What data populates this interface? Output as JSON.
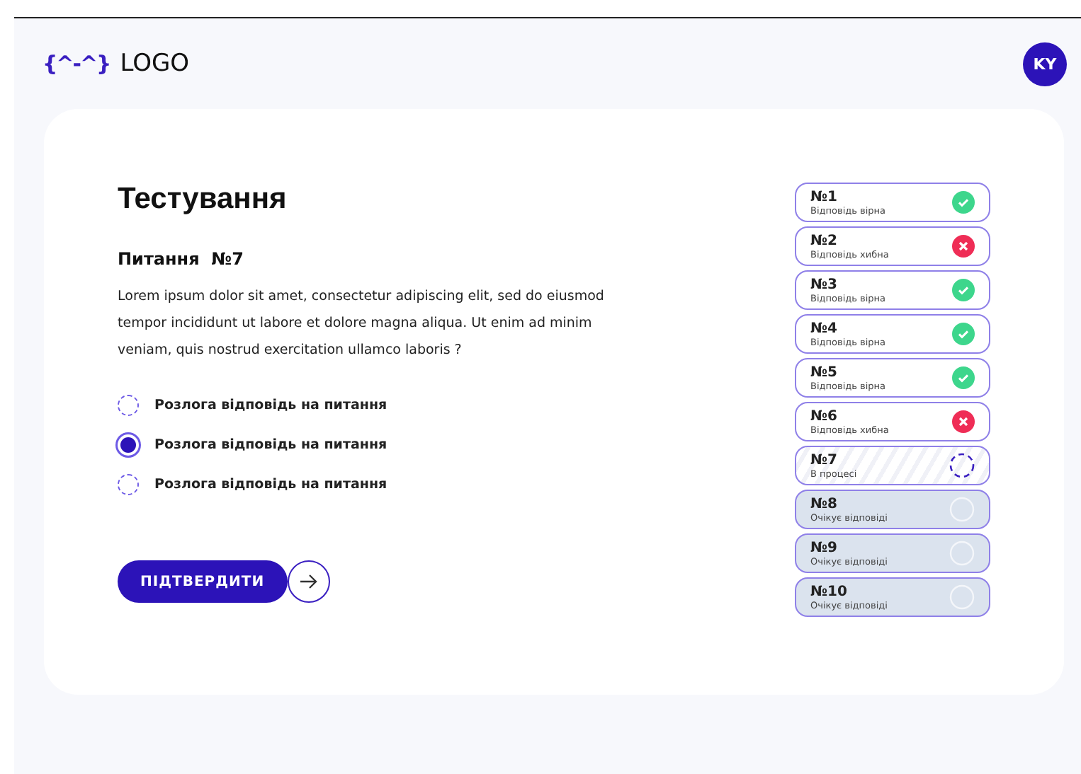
{
  "header": {
    "logo_mark": "{^-^}",
    "logo_text": "LOGO",
    "avatar": "KY"
  },
  "title": "Тестування",
  "question": {
    "label": "Питання",
    "number": "№7",
    "text": "Lorem ipsum dolor sit amet, consectetur adipiscing elit, sed do eiusmod tempor incididunt ut labore et dolore magna aliqua. Ut enim ad minim veniam, quis nostrud exercitation ullamco laboris ?"
  },
  "answers": [
    {
      "label": "Розлога відповідь на питання",
      "selected": false
    },
    {
      "label": "Розлога відповідь на питання",
      "selected": true
    },
    {
      "label": "Розлога відповідь на питання",
      "selected": false
    }
  ],
  "submit": {
    "label": "ПІДТВЕРДИТИ"
  },
  "progress": [
    {
      "number": "№1",
      "status": "Відповідь вірна",
      "kind": "correct"
    },
    {
      "number": "№2",
      "status": "Відповідь хибна",
      "kind": "wrong"
    },
    {
      "number": "№3",
      "status": "Відповідь вірна",
      "kind": "correct"
    },
    {
      "number": "№4",
      "status": "Відповідь вірна",
      "kind": "correct"
    },
    {
      "number": "№5",
      "status": "Відповідь вірна",
      "kind": "correct"
    },
    {
      "number": "№6",
      "status": "Відповідь хибна",
      "kind": "wrong"
    },
    {
      "number": "№7",
      "status": "В процесі",
      "kind": "current"
    },
    {
      "number": "№8",
      "status": "Очікує відповіді",
      "kind": "pending"
    },
    {
      "number": "№9",
      "status": "Очікує відповіді",
      "kind": "pending"
    },
    {
      "number": "№10",
      "status": "Очікує відповіді",
      "kind": "pending"
    }
  ]
}
